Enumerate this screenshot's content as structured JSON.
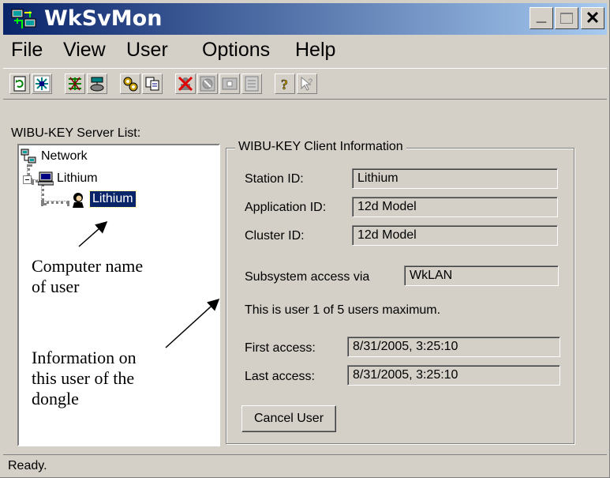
{
  "window": {
    "title": "WkSvMon",
    "controls": {
      "minimize": "_",
      "close": "✕"
    }
  },
  "menu": [
    "File",
    "View",
    "User",
    "Options",
    "Help"
  ],
  "toolbar": {
    "buttons": [
      "refresh-icon",
      "network-select-icon",
      "server-tree-icon",
      "server-icon",
      "settings-gears-icon",
      "copy-icon",
      "remove-user-icon",
      "disconnect-icon",
      "window-icon",
      "list-icon",
      "help-icon",
      "context-help-icon"
    ]
  },
  "server_list": {
    "label": "WIBU-KEY Server List:",
    "tree": {
      "root": "Network",
      "computer": "Lithium",
      "user": "Lithium"
    }
  },
  "annotations": {
    "computer_name": [
      "Computer name",
      "of user"
    ],
    "info": [
      "Information on",
      "this user of the",
      "dongle"
    ]
  },
  "client_info": {
    "legend": "WIBU-KEY Client Information",
    "station_label": "Station ID:",
    "station_value": "Lithium",
    "application_label": "Application ID:",
    "application_value": "12d Model",
    "cluster_label": "Cluster ID:",
    "cluster_value": "12d Model",
    "subsystem_label": "Subsystem access via",
    "subsystem_value": "WkLAN",
    "user_count_text": "This is user 1 of 5 users maximum.",
    "first_access_label": "First access:",
    "first_access_value": "8/31/2005, 3:25:10",
    "last_access_label": "Last access:",
    "last_access_value": "8/31/2005, 3:25:10",
    "cancel_button": "Cancel User"
  },
  "status": {
    "text": "Ready."
  }
}
